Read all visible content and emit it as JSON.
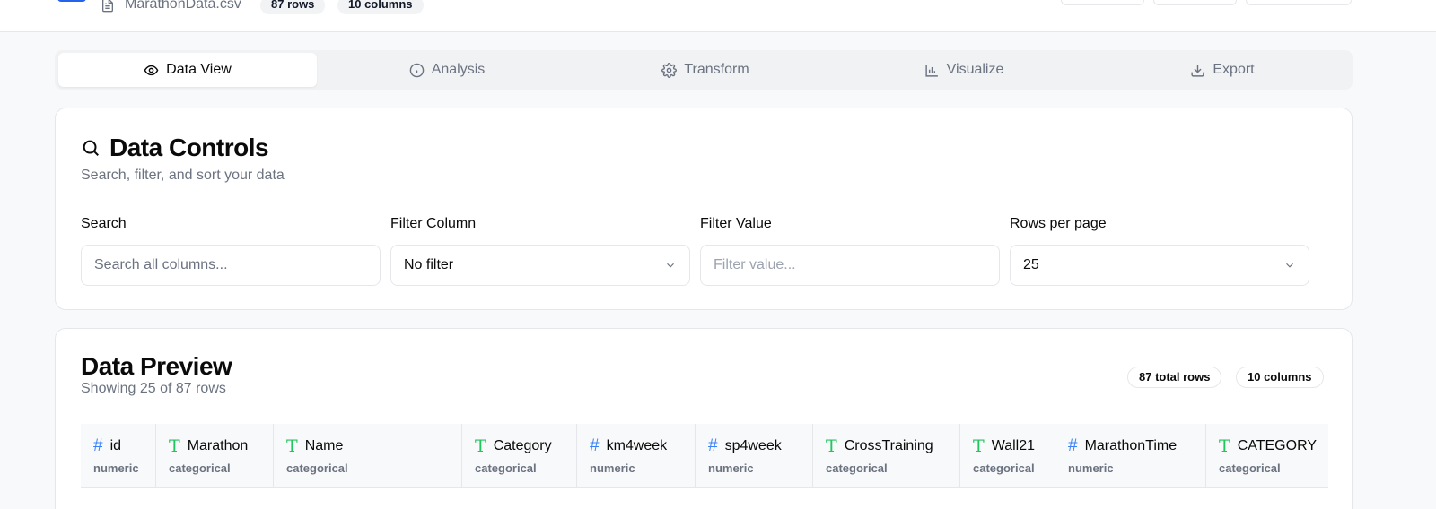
{
  "header": {
    "file_name": "MarathonData.csv",
    "rows_badge": "87 rows",
    "columns_badge": "10 columns"
  },
  "tabs": [
    {
      "label": "Data View",
      "icon": "eye-icon",
      "active": true
    },
    {
      "label": "Analysis",
      "icon": "info-icon",
      "active": false
    },
    {
      "label": "Transform",
      "icon": "gear-icon",
      "active": false
    },
    {
      "label": "Visualize",
      "icon": "bar-chart-icon",
      "active": false
    },
    {
      "label": "Export",
      "icon": "download-icon",
      "active": false
    }
  ],
  "controls": {
    "title": "Data Controls",
    "subtitle": "Search, filter, and sort your data",
    "search": {
      "label": "Search",
      "placeholder": "Search all columns..."
    },
    "filter_column": {
      "label": "Filter Column",
      "value": "No filter"
    },
    "filter_value": {
      "label": "Filter Value",
      "placeholder": "Filter value..."
    },
    "rows_per_page": {
      "label": "Rows per page",
      "value": "25"
    }
  },
  "preview": {
    "title": "Data Preview",
    "subtitle": "Showing 25 of 87 rows",
    "total_rows_badge": "87 total rows",
    "columns_badge": "10 columns",
    "columns": [
      {
        "name": "id",
        "type": "numeric"
      },
      {
        "name": "Marathon",
        "type": "categorical"
      },
      {
        "name": "Name",
        "type": "categorical"
      },
      {
        "name": "Category",
        "type": "categorical"
      },
      {
        "name": "km4week",
        "type": "numeric"
      },
      {
        "name": "sp4week",
        "type": "numeric"
      },
      {
        "name": "CrossTraining",
        "type": "categorical"
      },
      {
        "name": "Wall21",
        "type": "categorical"
      },
      {
        "name": "MarathonTime",
        "type": "numeric"
      },
      {
        "name": "CATEGORY",
        "type": "categorical"
      }
    ]
  },
  "colors": {
    "accent": "#2563eb",
    "numeric_icon": "#3b82f6",
    "categorical_icon": "#22c55e"
  }
}
